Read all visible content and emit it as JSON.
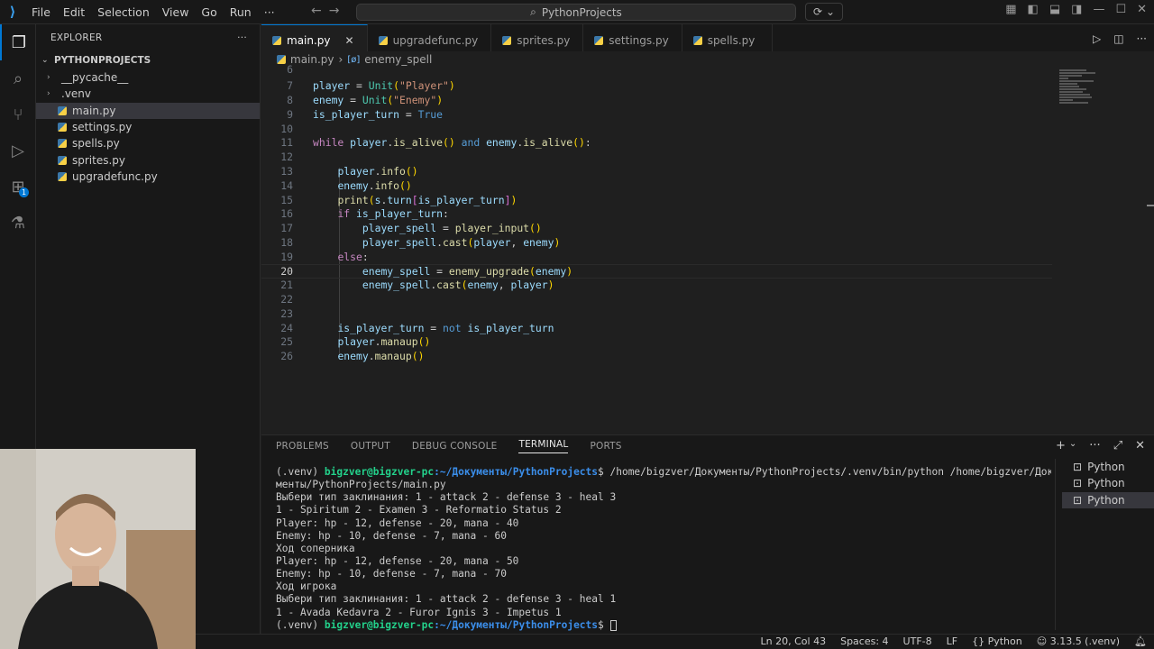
{
  "titlebar": {
    "menu": [
      "File",
      "Edit",
      "Selection",
      "View",
      "Go",
      "Run",
      "···"
    ],
    "command_center": "PythonProjects"
  },
  "sidebar": {
    "title": "EXPLORER",
    "more": "···",
    "root": "PYTHONPROJECTS",
    "items": [
      {
        "label": "__pycache__",
        "type": "folder"
      },
      {
        "label": ".venv",
        "type": "folder"
      },
      {
        "label": "main.py",
        "type": "file",
        "selected": true
      },
      {
        "label": "settings.py",
        "type": "file"
      },
      {
        "label": "spells.py",
        "type": "file"
      },
      {
        "label": "sprites.py",
        "type": "file"
      },
      {
        "label": "upgradefunc.py",
        "type": "file"
      }
    ]
  },
  "tabs": [
    "main.py",
    "upgradefunc.py",
    "sprites.py",
    "settings.py",
    "spells.py"
  ],
  "breadcrumb": {
    "file": "main.py",
    "symbol": "enemy_spell"
  },
  "editor": {
    "line_numbers": [
      "6",
      "7",
      "8",
      "9",
      "10",
      "11",
      "12",
      "13",
      "14",
      "15",
      "16",
      "17",
      "18",
      "19",
      "20",
      "21",
      "22",
      "23",
      "24",
      "25",
      "26"
    ],
    "current_line": "20"
  },
  "panel": {
    "tabs": [
      "PROBLEMS",
      "OUTPUT",
      "DEBUG CONSOLE",
      "TERMINAL",
      "PORTS"
    ],
    "active_tab": "TERMINAL",
    "terminal_lines": [
      {
        "prompt_env": "(.venv)",
        "user": "bigzver@bigzver-pc",
        "path": ":~/Документы/PythonProjects",
        "cmd": "$ /home/bigzver/Документы/PythonProjects/.venv/bin/python /home/bigzver/Доку"
      },
      {
        "text": "менты/PythonProjects/main.py"
      },
      {
        "text": "Выбери тип заклинания: 1 - attack 2 - defense 3 - heal 3"
      },
      {
        "text": "1 - Spiritum 2 - Examen 3 - Reformatio Status 2"
      },
      {
        "text": "Player: hp - 12, defense - 20, mana - 40"
      },
      {
        "text": "Enemy: hp - 10, defense - 7, mana - 60"
      },
      {
        "text": "Ход соперника"
      },
      {
        "text": "Player: hp - 12, defense - 20, mana - 50"
      },
      {
        "text": "Enemy: hp - 10, defense - 7, mana - 70"
      },
      {
        "text": "Ход игрока"
      },
      {
        "text": "Выбери тип заклинания: 1 - attack 2 - defense 3 - heal 1"
      },
      {
        "text": "1 - Avada Kedavra 2 - Furor Ignis 3 - Impetus 1"
      },
      {
        "prompt_env": "(.venv)",
        "user": "bigzver@bigzver-pc",
        "path": ":~/Документы/PythonProjects",
        "cmd": "$ "
      }
    ],
    "terminals": [
      "Python",
      "Python",
      "Python"
    ]
  },
  "statusbar": {
    "position": "Ln 20, Col 43",
    "spaces": "Spaces: 4",
    "encoding": "UTF-8",
    "eol": "LF",
    "language": "Python",
    "interpreter": "3.13.5 (.venv)"
  },
  "colors": {
    "accent": "#0078d4",
    "bg": "#1f1f1f",
    "sidebar_bg": "#181818"
  }
}
